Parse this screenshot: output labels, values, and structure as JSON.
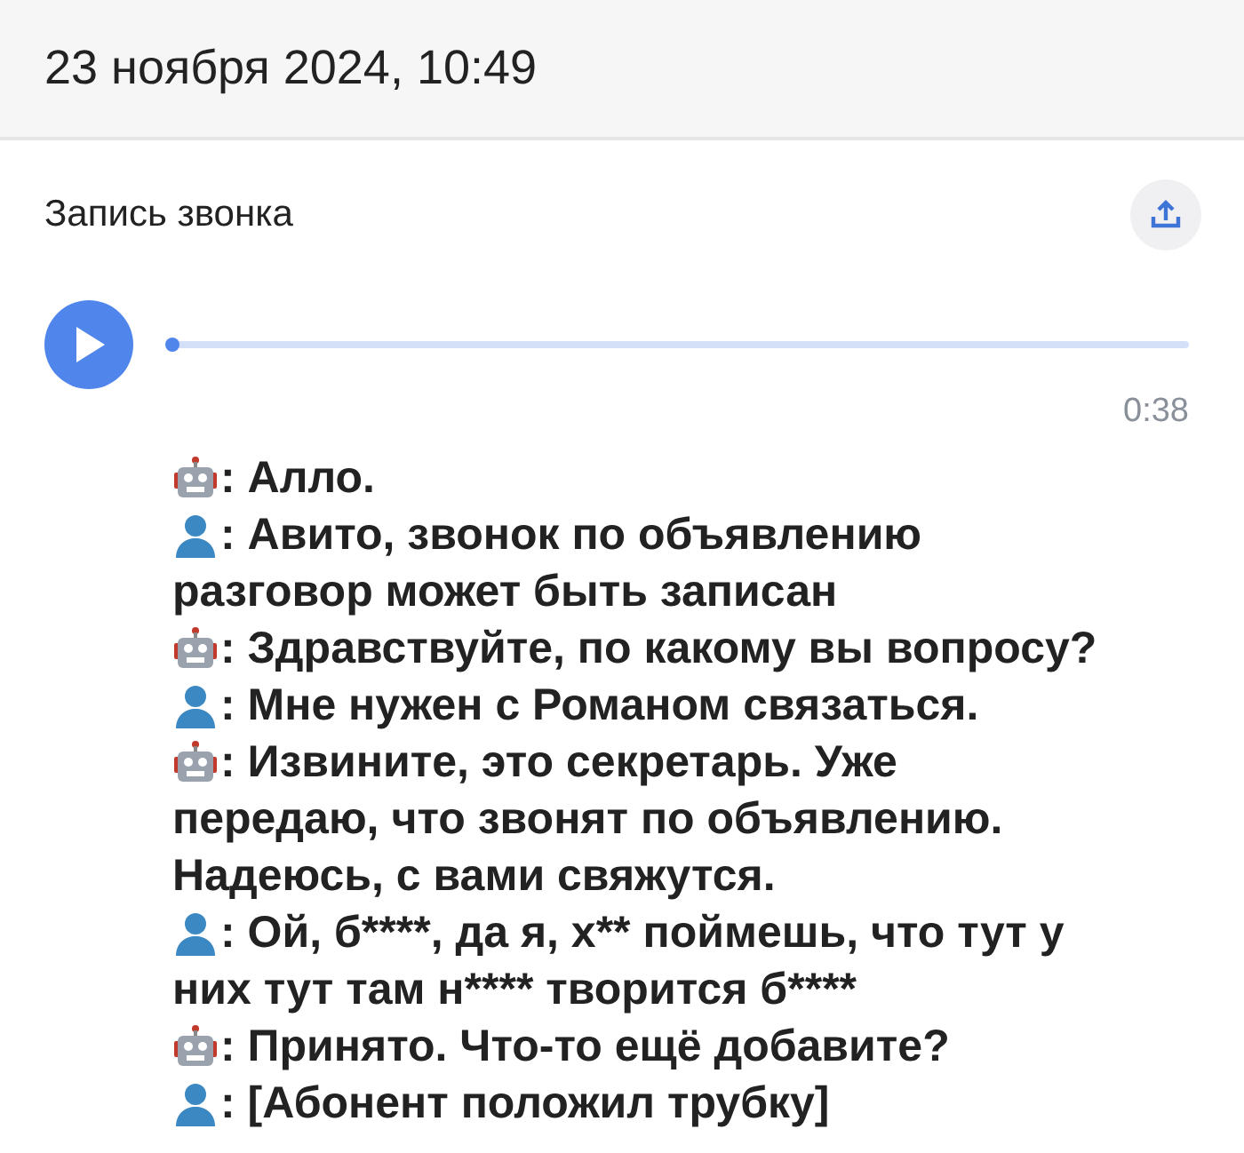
{
  "header": {
    "date": "23 ноября 2024, 10:49"
  },
  "recording": {
    "title": "Запись звонка",
    "progress": {
      "level": 0
    },
    "duration": "0:38"
  },
  "messages": [
    {
      "kind": "bot",
      "lines": [
        ": Алло."
      ]
    },
    {
      "kind": "user",
      "lines": [
        ": Авито, звонок по объявлению",
        "разговор может быть записан"
      ]
    },
    {
      "kind": "bot",
      "lines": [
        ": Здравствуйте, по какому вы вопросу?"
      ]
    },
    {
      "kind": "user",
      "lines": [
        ": Мне нужен с Романом связаться."
      ]
    },
    {
      "kind": "bot",
      "lines": [
        ": Извините, это секретарь. Уже",
        "передаю, что звонят по объявлению.",
        "Надеюсь, с вами свяжутся."
      ]
    },
    {
      "kind": "user",
      "lines": [
        ": Ой, б****, да я, х** поймешь, что тут у",
        "них тут там н**** творится б****"
      ]
    },
    {
      "kind": "bot",
      "lines": [
        ": Принято. Что-то ещё добавите?"
      ]
    },
    {
      "kind": "user",
      "lines": [
        ": [Абонент положил трубку]"
      ]
    }
  ]
}
